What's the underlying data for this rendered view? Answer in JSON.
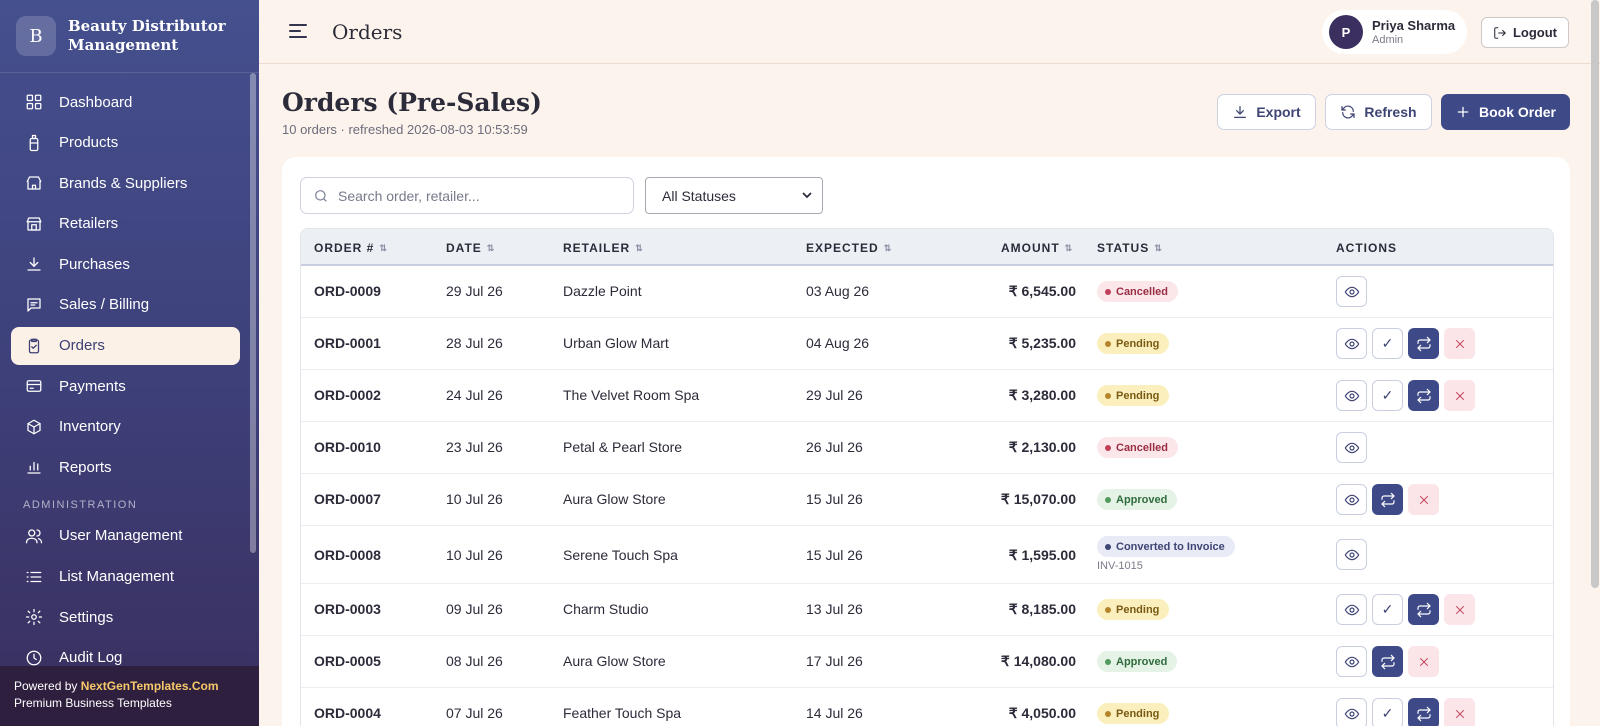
{
  "brand": {
    "logo_letter": "B",
    "name_line1": "Beauty Distributor",
    "name_line2": "Management"
  },
  "sidebar": {
    "items": [
      {
        "label": "Dashboard",
        "icon": "dashboard-icon"
      },
      {
        "label": "Products",
        "icon": "bottle-icon"
      },
      {
        "label": "Brands & Suppliers",
        "icon": "store-icon"
      },
      {
        "label": "Retailers",
        "icon": "shop-icon"
      },
      {
        "label": "Purchases",
        "icon": "download-icon"
      },
      {
        "label": "Sales / Billing",
        "icon": "chat-icon"
      },
      {
        "label": "Orders",
        "icon": "clipboard-icon",
        "active": true
      },
      {
        "label": "Payments",
        "icon": "credit-card-icon"
      },
      {
        "label": "Inventory",
        "icon": "box-icon"
      },
      {
        "label": "Reports",
        "icon": "bar-chart-icon"
      }
    ],
    "admin_section": "ADMINISTRATION",
    "admin_items": [
      {
        "label": "User Management",
        "icon": "users-icon"
      },
      {
        "label": "List Management",
        "icon": "list-icon"
      },
      {
        "label": "Settings",
        "icon": "gear-icon"
      },
      {
        "label": "Audit Log",
        "icon": "clock-icon"
      }
    ],
    "powered_prefix": "Powered by",
    "powered_brand": "NextGenTemplates.Com",
    "powered_tagline": "Premium Business Templates"
  },
  "topbar": {
    "title": "Orders",
    "user_initial": "P",
    "user_name": "Priya Sharma",
    "user_role": "Admin",
    "logout_label": "Logout"
  },
  "page": {
    "title": "Orders (Pre-Sales)",
    "subtitle": "10 orders · refreshed 2026-08-03 10:53:59",
    "export_label": "Export",
    "refresh_label": "Refresh",
    "book_label": "Book Order"
  },
  "filters": {
    "search_placeholder": "Search order, retailer...",
    "status_selected": "All Statuses"
  },
  "table": {
    "headers": {
      "order": "ORDER #",
      "date": "DATE",
      "retailer": "RETAILER",
      "expected": "EXPECTED",
      "amount": "AMOUNT",
      "status": "STATUS",
      "actions": "ACTIONS"
    },
    "rows": [
      {
        "order": "ORD-0009",
        "date": "29 Jul 26",
        "retailer": "Dazzle Point",
        "expected": "03 Aug 26",
        "amount": "₹ 6,545.00",
        "status": "Cancelled",
        "status_type": "cancelled",
        "actions": [
          "view"
        ]
      },
      {
        "order": "ORD-0001",
        "date": "28 Jul 26",
        "retailer": "Urban Glow Mart",
        "expected": "04 Aug 26",
        "amount": "₹ 5,235.00",
        "status": "Pending",
        "status_type": "pending",
        "actions": [
          "view",
          "approve",
          "convert",
          "cancel"
        ]
      },
      {
        "order": "ORD-0002",
        "date": "24 Jul 26",
        "retailer": "The Velvet Room Spa",
        "expected": "29 Jul 26",
        "amount": "₹ 3,280.00",
        "status": "Pending",
        "status_type": "pending",
        "actions": [
          "view",
          "approve",
          "convert",
          "cancel"
        ]
      },
      {
        "order": "ORD-0010",
        "date": "23 Jul 26",
        "retailer": "Petal & Pearl Store",
        "expected": "26 Jul 26",
        "amount": "₹ 2,130.00",
        "status": "Cancelled",
        "status_type": "cancelled",
        "actions": [
          "view"
        ]
      },
      {
        "order": "ORD-0007",
        "date": "10 Jul 26",
        "retailer": "Aura Glow Store",
        "expected": "15 Jul 26",
        "amount": "₹ 15,070.00",
        "status": "Approved",
        "status_type": "approved",
        "actions": [
          "view",
          "convert",
          "cancel"
        ]
      },
      {
        "order": "ORD-0008",
        "date": "10 Jul 26",
        "retailer": "Serene Touch Spa",
        "expected": "15 Jul 26",
        "amount": "₹ 1,595.00",
        "status": "Converted to Invoice",
        "status_type": "converted",
        "invoice": "INV-1015",
        "actions": [
          "view"
        ]
      },
      {
        "order": "ORD-0003",
        "date": "09 Jul 26",
        "retailer": "Charm Studio",
        "expected": "13 Jul 26",
        "amount": "₹ 8,185.00",
        "status": "Pending",
        "status_type": "pending",
        "actions": [
          "view",
          "approve",
          "convert",
          "cancel"
        ]
      },
      {
        "order": "ORD-0005",
        "date": "08 Jul 26",
        "retailer": "Aura Glow Store",
        "expected": "17 Jul 26",
        "amount": "₹ 14,080.00",
        "status": "Approved",
        "status_type": "approved",
        "actions": [
          "view",
          "convert",
          "cancel"
        ]
      },
      {
        "order": "ORD-0004",
        "date": "07 Jul 26",
        "retailer": "Feather Touch Spa",
        "expected": "14 Jul 26",
        "amount": "₹ 4,050.00",
        "status": "Pending",
        "status_type": "pending",
        "actions": [
          "view",
          "approve",
          "convert",
          "cancel"
        ]
      }
    ]
  },
  "colors": {
    "primary": "#3e4a88",
    "sidebar_top": "#45508e",
    "page_bg": "#fcf3ec",
    "cancelled": "#c0405a",
    "pending": "#b4852a",
    "approved": "#4f9a5c"
  }
}
